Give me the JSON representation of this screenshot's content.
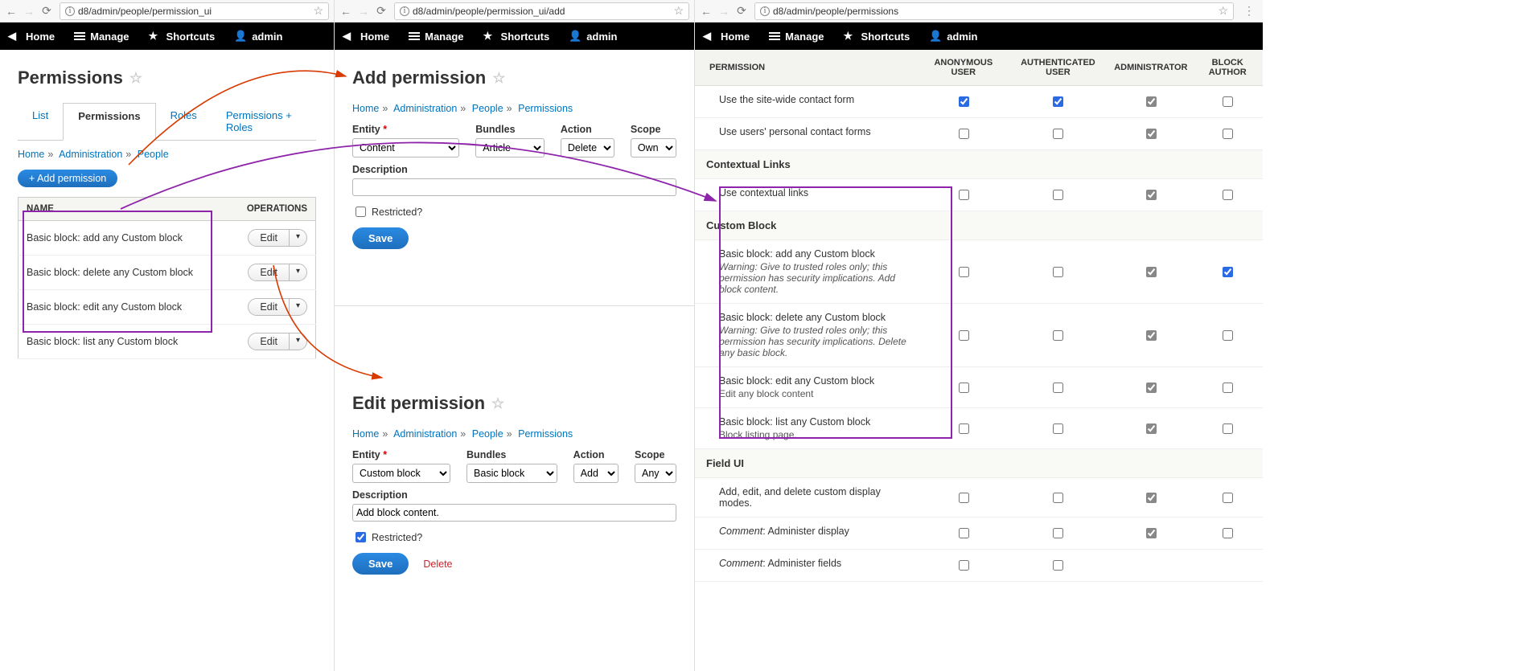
{
  "browser": {
    "pane1_url": "d8/admin/people/permission_ui",
    "pane2_url": "d8/admin/people/permission_ui/add",
    "pane3_url": "d8/admin/people/permissions"
  },
  "toolbar": {
    "home": "Home",
    "manage": "Manage",
    "shortcuts": "Shortcuts",
    "admin": "admin"
  },
  "pane1": {
    "title": "Permissions",
    "tabs": {
      "list": "List",
      "permissions": "Permissions",
      "roles": "Roles",
      "perm_roles": "Permissions + Roles"
    },
    "crumbs": {
      "home": "Home",
      "admin": "Administration",
      "people": "People"
    },
    "add_btn": "+ Add permission",
    "table": {
      "col_name": "NAME",
      "col_ops": "OPERATIONS",
      "edit": "Edit",
      "rows": [
        "Basic block: add any Custom block",
        "Basic block: delete any Custom block",
        "Basic block: edit any Custom block",
        "Basic block: list any Custom block"
      ]
    }
  },
  "pane2_add": {
    "title": "Add permission",
    "crumbs": {
      "home": "Home",
      "admin": "Administration",
      "people": "People",
      "perm": "Permissions"
    },
    "labels": {
      "entity": "Entity",
      "bundles": "Bundles",
      "action": "Action",
      "scope": "Scope",
      "desc": "Description",
      "restricted": "Restricted?",
      "save": "Save"
    },
    "values": {
      "entity": "Content",
      "bundles": "Article",
      "action": "Delete",
      "scope": "Own",
      "desc": ""
    }
  },
  "pane2_edit": {
    "title": "Edit permission",
    "crumbs": {
      "home": "Home",
      "admin": "Administration",
      "people": "People",
      "perm": "Permissions"
    },
    "labels": {
      "entity": "Entity",
      "bundles": "Bundles",
      "action": "Action",
      "scope": "Scope",
      "desc": "Description",
      "restricted": "Restricted?",
      "save": "Save",
      "delete": "Delete"
    },
    "values": {
      "entity": "Custom block",
      "bundles": "Basic block",
      "action": "Add",
      "scope": "Any",
      "desc": "Add block content."
    }
  },
  "pane3": {
    "headers": {
      "perm": "PERMISSION",
      "anon": "ANONYMOUS USER",
      "auth": "AUTHENTICATED USER",
      "admin": "ADMINISTRATOR",
      "author": "BLOCK AUTHOR"
    },
    "rows": [
      {
        "type": "perm",
        "name": "Use the site-wide contact form",
        "c": [
          true,
          true,
          "fixed",
          false
        ]
      },
      {
        "type": "perm",
        "name": "Use users' personal contact forms",
        "c": [
          false,
          false,
          "fixed",
          false
        ]
      },
      {
        "type": "section",
        "name": "Contextual Links"
      },
      {
        "type": "perm",
        "name": "Use contextual links",
        "c": [
          false,
          false,
          "fixed",
          false
        ]
      },
      {
        "type": "section",
        "name": "Custom Block"
      },
      {
        "type": "perm",
        "name": "Basic block: add any Custom block",
        "warn": "Warning: Give to trusted roles only; this permission has security implications.",
        "extra": " Add block content.",
        "c": [
          false,
          false,
          "fixed",
          true
        ]
      },
      {
        "type": "perm",
        "name": "Basic block: delete any Custom block",
        "warn": "Warning: Give to trusted roles only; this permission has security implications.",
        "extra": " Delete any basic block.",
        "c": [
          false,
          false,
          "fixed",
          false
        ]
      },
      {
        "type": "perm",
        "name": "Basic block: edit any Custom block",
        "sub": "Edit any block content",
        "c": [
          false,
          false,
          "fixed",
          false
        ]
      },
      {
        "type": "perm",
        "name": "Basic block: list any Custom block",
        "sub": "Block listing page.",
        "c": [
          false,
          false,
          "fixed",
          false
        ]
      },
      {
        "type": "section",
        "name": "Field UI"
      },
      {
        "type": "perm",
        "name": "Add, edit, and delete custom display modes.",
        "c": [
          false,
          false,
          "fixed",
          false
        ]
      },
      {
        "type": "perm",
        "name_html": "<i>Comment</i>: Administer display",
        "c": [
          false,
          false,
          "fixed",
          false
        ]
      },
      {
        "type": "perm",
        "name_html": "<i>Comment</i>: Administer fields",
        "c": [
          false,
          false,
          null,
          null
        ]
      }
    ]
  }
}
